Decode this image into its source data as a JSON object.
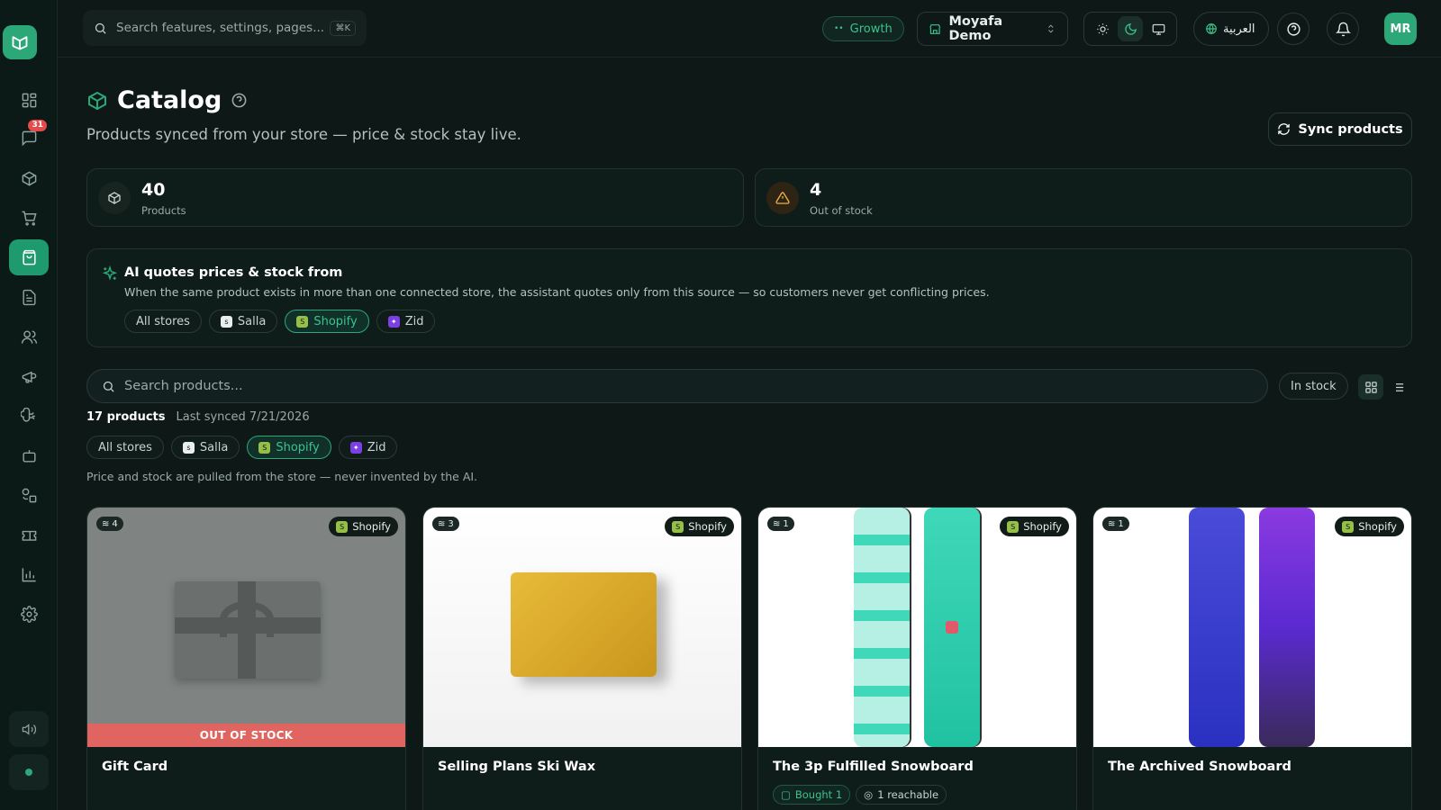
{
  "header": {
    "search_placeholder": "Search features, settings, pages...",
    "search_shortcut": "⌘K",
    "plan": "Growth",
    "store": "Moyafa Demo",
    "language": "العربية",
    "avatar": "MR"
  },
  "sidebar": {
    "inbox_badge": "31",
    "items": [
      "dashboard",
      "inbox",
      "products",
      "cart",
      "catalog",
      "documents",
      "customers",
      "campaigns",
      "automation",
      "bots",
      "integrations",
      "billing",
      "analytics",
      "settings"
    ]
  },
  "page": {
    "title": "Catalog",
    "subtitle": "Products synced from your store — price & stock stay live.",
    "sync_label": "Sync products"
  },
  "stats": [
    {
      "value": "40",
      "label": "Products"
    },
    {
      "value": "4",
      "label": "Out of stock"
    }
  ],
  "ai": {
    "title": "AI quotes prices & stock from",
    "description": "When the same product exists in more than one connected store, the assistant quotes only from this source — so customers never get conflicting prices.",
    "sources": [
      "All stores",
      "Salla",
      "Shopify",
      "Zid"
    ],
    "selected": "Shopify"
  },
  "filters": {
    "search_placeholder": "Search products...",
    "stock_filter": "In stock",
    "count_text": "17 products",
    "last_synced": "Last synced 7/21/2026",
    "stores": [
      "All stores",
      "Salla",
      "Shopify",
      "Zid"
    ],
    "selected_store": "Shopify",
    "note": "Price and stock are pulled from the store — never invented by the AI."
  },
  "products": [
    {
      "name": "Gift Card",
      "variants": "4",
      "source": "Shopify",
      "status": "OUT OF STOCK"
    },
    {
      "name": "Selling Plans Ski Wax",
      "variants": "3",
      "source": "Shopify"
    },
    {
      "name": "The 3p Fulfilled Snowboard",
      "variants": "1",
      "source": "Shopify",
      "tags": [
        "Bought 1",
        "1 reachable"
      ]
    },
    {
      "name": "The Archived Snowboard",
      "variants": "1",
      "source": "Shopify"
    }
  ],
  "colors": {
    "accent": "#2ba778",
    "background": "#0e1816",
    "out_of_stock": "#e06560"
  }
}
